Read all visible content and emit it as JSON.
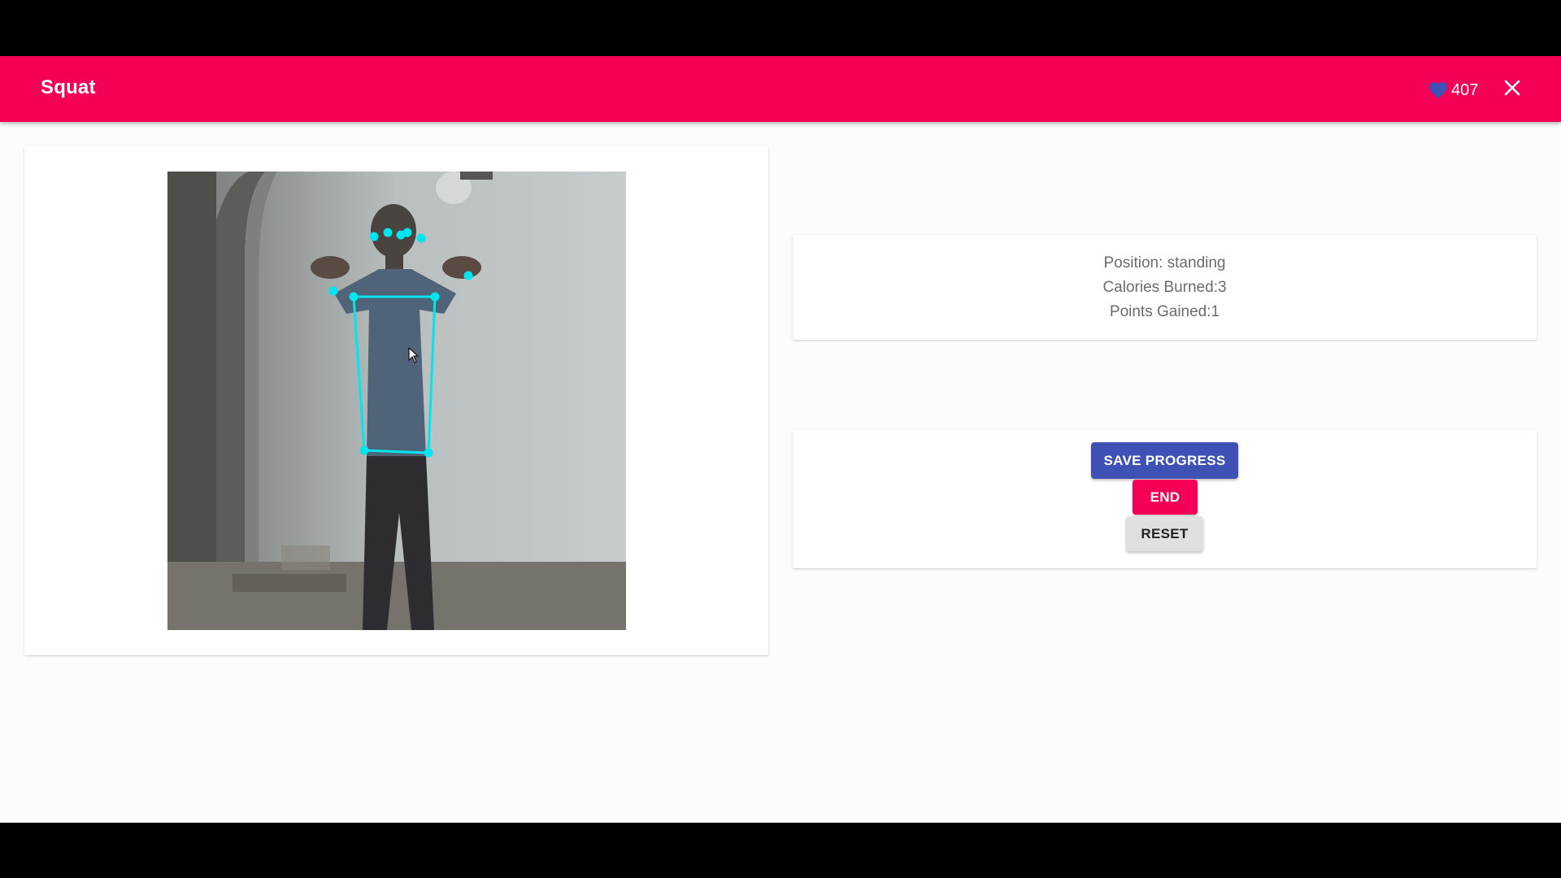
{
  "appbar": {
    "title": "Squat",
    "points_value": "407",
    "points_icon": "heart-icon",
    "close_icon": "close-icon"
  },
  "camera": {
    "pose_keypoint_color": "#00e5ee"
  },
  "stats": {
    "position": "Position: standing",
    "calories": "Calories Burned:3",
    "points": "Points Gained:1"
  },
  "actions": {
    "save_label": "SAVE PROGRESS",
    "end_label": "END",
    "reset_label": "RESET"
  },
  "colors": {
    "appbar": "#f50057",
    "primary_button": "#3f51b5",
    "secondary_button": "#f50057",
    "default_button": "#e0e0e0",
    "heart": "#3f51b5"
  }
}
